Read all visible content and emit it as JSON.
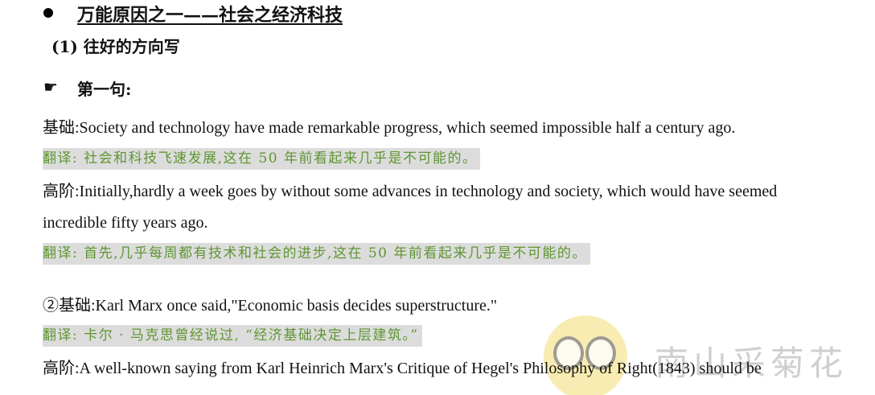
{
  "heading": "万能原因之一——社会之经济科技",
  "subheading": "(1) 往好的方向写",
  "section_label": "第一句:",
  "pointer_icon": "☛",
  "paragraphs": {
    "p1": "基础:Society and technology have made remarkable progress, which seemed impossible half a century ago.",
    "t1": "翻译: 社会和科技飞速发展,这在 50 年前看起来几乎是不可能的。",
    "p2_line1": "高阶:Initially,hardly a week goes by without some advances in technology and society, which would have seemed",
    "p2_line2": "incredible fifty years ago.",
    "t2": "翻译: 首先,几乎每周都有技术和社会的进步,这在 50 年前看起来几乎是不可能的。",
    "p3": "②基础:Karl Marx once said,\"Economic basis decides superstructure.\"",
    "t3": "翻译: 卡尔 · 马克思曾经说过, “经济基础决定上层建筑。”",
    "p4": "高阶:A well-known saying from Karl Heinrich Marx's Critique of Hegel's Philosophy of Right(1843) should be"
  },
  "watermark": "南山采菊花",
  "colors": {
    "translation_text": "#5f9632",
    "translation_bg": "#dcdcdc"
  }
}
